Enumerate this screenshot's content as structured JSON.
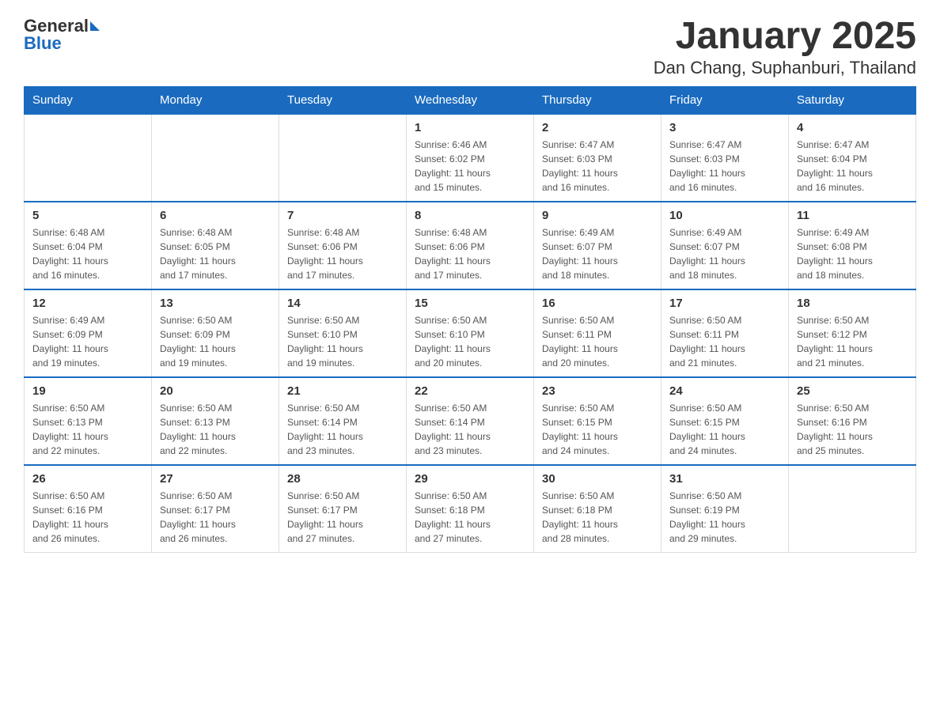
{
  "logo": {
    "text_general": "General",
    "text_blue": "Blue"
  },
  "title": "January 2025",
  "subtitle": "Dan Chang, Suphanburi, Thailand",
  "days_of_week": [
    "Sunday",
    "Monday",
    "Tuesday",
    "Wednesday",
    "Thursday",
    "Friday",
    "Saturday"
  ],
  "weeks": [
    [
      {
        "day": "",
        "info": ""
      },
      {
        "day": "",
        "info": ""
      },
      {
        "day": "",
        "info": ""
      },
      {
        "day": "1",
        "info": "Sunrise: 6:46 AM\nSunset: 6:02 PM\nDaylight: 11 hours\nand 15 minutes."
      },
      {
        "day": "2",
        "info": "Sunrise: 6:47 AM\nSunset: 6:03 PM\nDaylight: 11 hours\nand 16 minutes."
      },
      {
        "day": "3",
        "info": "Sunrise: 6:47 AM\nSunset: 6:03 PM\nDaylight: 11 hours\nand 16 minutes."
      },
      {
        "day": "4",
        "info": "Sunrise: 6:47 AM\nSunset: 6:04 PM\nDaylight: 11 hours\nand 16 minutes."
      }
    ],
    [
      {
        "day": "5",
        "info": "Sunrise: 6:48 AM\nSunset: 6:04 PM\nDaylight: 11 hours\nand 16 minutes."
      },
      {
        "day": "6",
        "info": "Sunrise: 6:48 AM\nSunset: 6:05 PM\nDaylight: 11 hours\nand 17 minutes."
      },
      {
        "day": "7",
        "info": "Sunrise: 6:48 AM\nSunset: 6:06 PM\nDaylight: 11 hours\nand 17 minutes."
      },
      {
        "day": "8",
        "info": "Sunrise: 6:48 AM\nSunset: 6:06 PM\nDaylight: 11 hours\nand 17 minutes."
      },
      {
        "day": "9",
        "info": "Sunrise: 6:49 AM\nSunset: 6:07 PM\nDaylight: 11 hours\nand 18 minutes."
      },
      {
        "day": "10",
        "info": "Sunrise: 6:49 AM\nSunset: 6:07 PM\nDaylight: 11 hours\nand 18 minutes."
      },
      {
        "day": "11",
        "info": "Sunrise: 6:49 AM\nSunset: 6:08 PM\nDaylight: 11 hours\nand 18 minutes."
      }
    ],
    [
      {
        "day": "12",
        "info": "Sunrise: 6:49 AM\nSunset: 6:09 PM\nDaylight: 11 hours\nand 19 minutes."
      },
      {
        "day": "13",
        "info": "Sunrise: 6:50 AM\nSunset: 6:09 PM\nDaylight: 11 hours\nand 19 minutes."
      },
      {
        "day": "14",
        "info": "Sunrise: 6:50 AM\nSunset: 6:10 PM\nDaylight: 11 hours\nand 19 minutes."
      },
      {
        "day": "15",
        "info": "Sunrise: 6:50 AM\nSunset: 6:10 PM\nDaylight: 11 hours\nand 20 minutes."
      },
      {
        "day": "16",
        "info": "Sunrise: 6:50 AM\nSunset: 6:11 PM\nDaylight: 11 hours\nand 20 minutes."
      },
      {
        "day": "17",
        "info": "Sunrise: 6:50 AM\nSunset: 6:11 PM\nDaylight: 11 hours\nand 21 minutes."
      },
      {
        "day": "18",
        "info": "Sunrise: 6:50 AM\nSunset: 6:12 PM\nDaylight: 11 hours\nand 21 minutes."
      }
    ],
    [
      {
        "day": "19",
        "info": "Sunrise: 6:50 AM\nSunset: 6:13 PM\nDaylight: 11 hours\nand 22 minutes."
      },
      {
        "day": "20",
        "info": "Sunrise: 6:50 AM\nSunset: 6:13 PM\nDaylight: 11 hours\nand 22 minutes."
      },
      {
        "day": "21",
        "info": "Sunrise: 6:50 AM\nSunset: 6:14 PM\nDaylight: 11 hours\nand 23 minutes."
      },
      {
        "day": "22",
        "info": "Sunrise: 6:50 AM\nSunset: 6:14 PM\nDaylight: 11 hours\nand 23 minutes."
      },
      {
        "day": "23",
        "info": "Sunrise: 6:50 AM\nSunset: 6:15 PM\nDaylight: 11 hours\nand 24 minutes."
      },
      {
        "day": "24",
        "info": "Sunrise: 6:50 AM\nSunset: 6:15 PM\nDaylight: 11 hours\nand 24 minutes."
      },
      {
        "day": "25",
        "info": "Sunrise: 6:50 AM\nSunset: 6:16 PM\nDaylight: 11 hours\nand 25 minutes."
      }
    ],
    [
      {
        "day": "26",
        "info": "Sunrise: 6:50 AM\nSunset: 6:16 PM\nDaylight: 11 hours\nand 26 minutes."
      },
      {
        "day": "27",
        "info": "Sunrise: 6:50 AM\nSunset: 6:17 PM\nDaylight: 11 hours\nand 26 minutes."
      },
      {
        "day": "28",
        "info": "Sunrise: 6:50 AM\nSunset: 6:17 PM\nDaylight: 11 hours\nand 27 minutes."
      },
      {
        "day": "29",
        "info": "Sunrise: 6:50 AM\nSunset: 6:18 PM\nDaylight: 11 hours\nand 27 minutes."
      },
      {
        "day": "30",
        "info": "Sunrise: 6:50 AM\nSunset: 6:18 PM\nDaylight: 11 hours\nand 28 minutes."
      },
      {
        "day": "31",
        "info": "Sunrise: 6:50 AM\nSunset: 6:19 PM\nDaylight: 11 hours\nand 29 minutes."
      },
      {
        "day": "",
        "info": ""
      }
    ]
  ]
}
